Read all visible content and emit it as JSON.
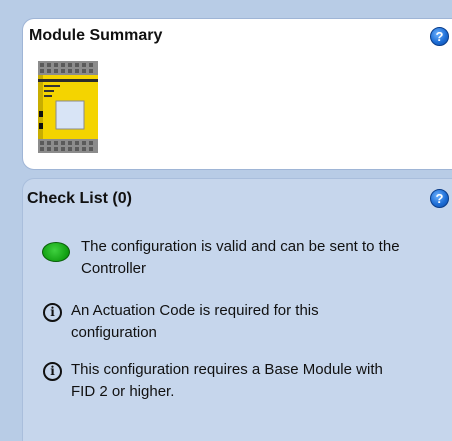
{
  "module_summary": {
    "title": "Module Summary",
    "help_glyph": "?",
    "module_image": {
      "icon": "safety-controller-module",
      "colors": {
        "body": "#f4d400",
        "terminal": "#9a9a9a",
        "window": "#d8e4f6"
      }
    }
  },
  "check_list": {
    "title": "Check List (0)",
    "help_glyph": "?",
    "items": [
      {
        "status": "valid",
        "icon": "green-status-icon",
        "text": "The configuration is valid and can be sent to the Controller"
      },
      {
        "status": "info",
        "icon": "info-icon",
        "glyph": "i",
        "text": "An Actuation Code is required for this configuration"
      },
      {
        "status": "info",
        "icon": "info-icon",
        "glyph": "i",
        "text": "This configuration requires a Base Module with FID 2 or higher."
      }
    ]
  }
}
